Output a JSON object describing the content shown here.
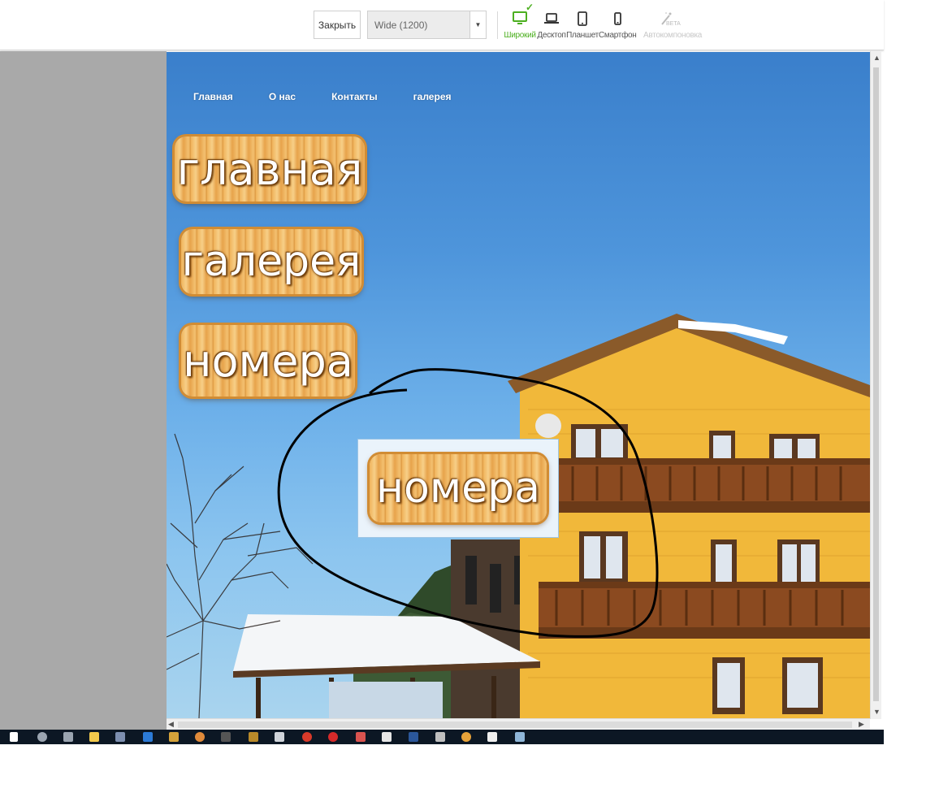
{
  "toolbar": {
    "close_label": "Закрыть",
    "layout_select": {
      "value": "Wide (1200)"
    },
    "devices": [
      {
        "label": "Широкий",
        "icon": "monitor-icon",
        "state": "active"
      },
      {
        "label": "Десктоп",
        "icon": "laptop-icon",
        "state": "normal"
      },
      {
        "label": "Планшет",
        "icon": "tablet-icon",
        "state": "normal"
      },
      {
        "label": "Смартфон",
        "icon": "smartphone-icon",
        "state": "normal"
      },
      {
        "label": "Автокомпоновка",
        "icon": "magic-wand-icon",
        "state": "disabled",
        "badge": "BETA"
      }
    ]
  },
  "site": {
    "nav": [
      "Главная",
      "О нас",
      "Контакты",
      "галерея"
    ],
    "wood_buttons": [
      "главная",
      "галерея",
      "номера"
    ],
    "selected_button": "номера"
  },
  "colors": {
    "accent_green": "#4caf20",
    "sky_top": "#3a7fcb",
    "wood": "#f0b35a",
    "taskbar": "#0c1724"
  }
}
